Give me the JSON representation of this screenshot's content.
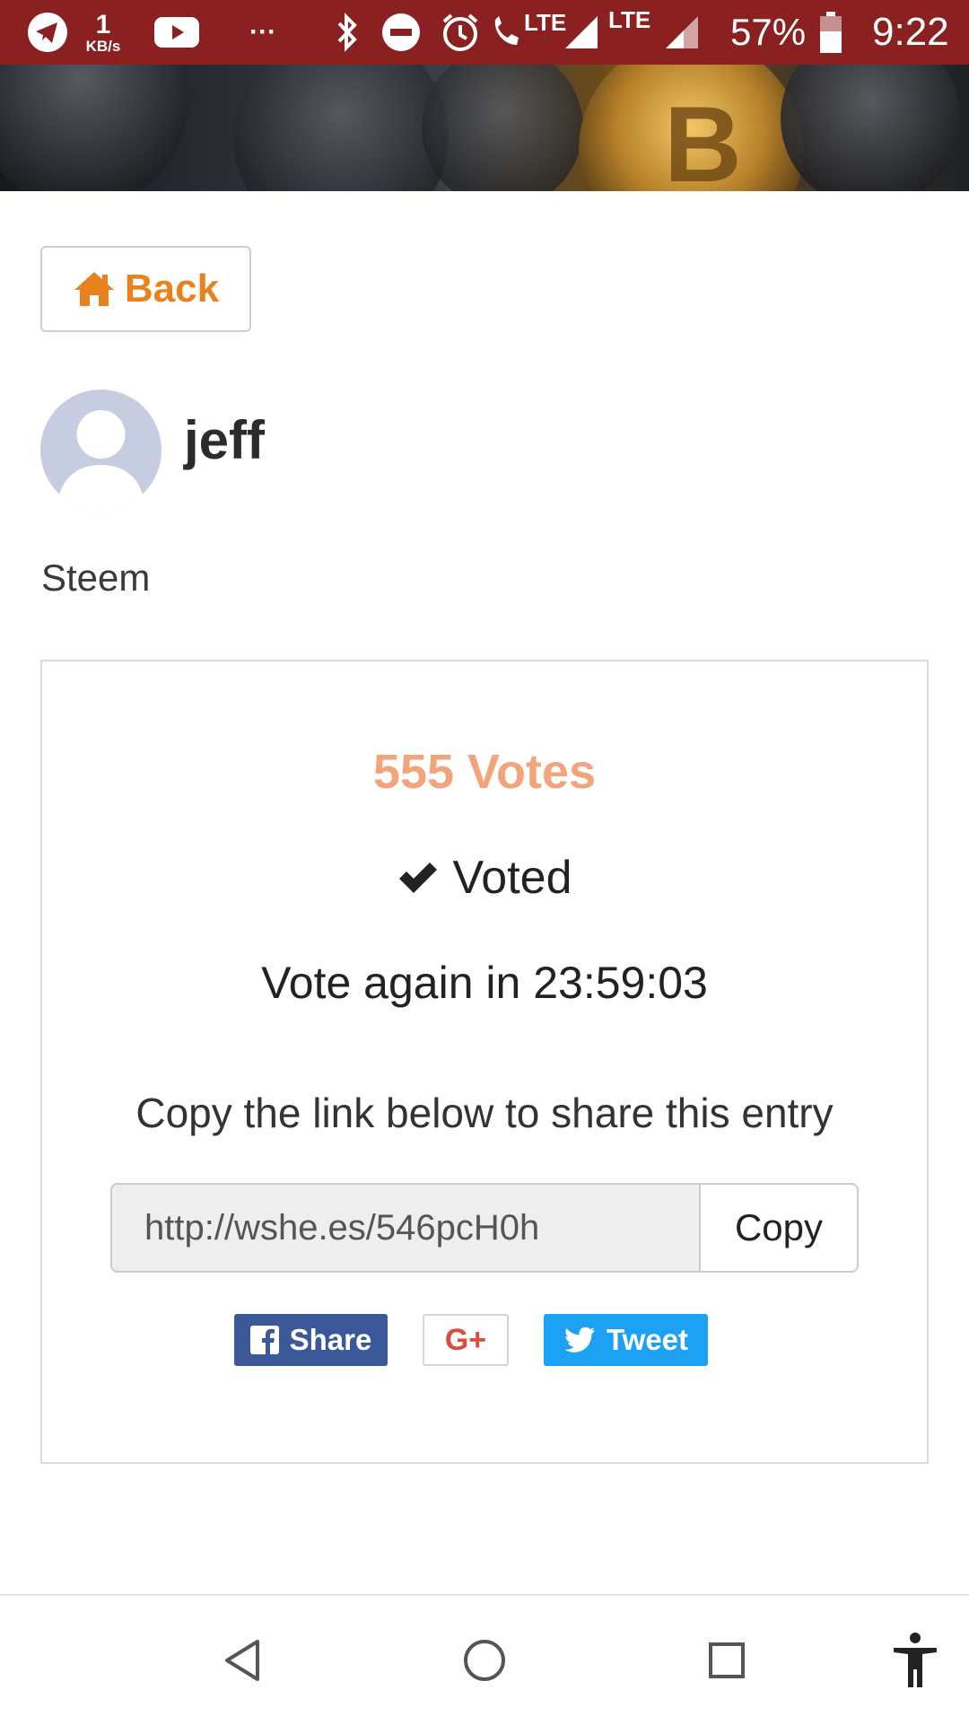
{
  "status_bar": {
    "data_speed": "1",
    "data_unit": "KB/s",
    "overflow": "···",
    "lte_call": "LTE",
    "lte": "LTE",
    "battery": "57%",
    "time": "9:22"
  },
  "page": {
    "back_label": "Back",
    "username": "jeff",
    "subtitle": "Steem"
  },
  "card": {
    "votes": "555 Votes",
    "voted": "Voted",
    "vote_again": "Vote again in 23:59:03",
    "copy_hint": "Copy the link below to share this entry",
    "link_value": "http://wshe.es/546pcH0h",
    "copy_label": "Copy"
  },
  "share": {
    "facebook_label": "Share",
    "google_label": "G+",
    "twitter_label": "Tweet"
  },
  "colors": {
    "accent": "#e8821e",
    "votes": "#f2a57a",
    "status_bar": "#8a2020",
    "facebook": "#3b5998",
    "twitter": "#1da1f2",
    "google": "#dd4b39"
  }
}
